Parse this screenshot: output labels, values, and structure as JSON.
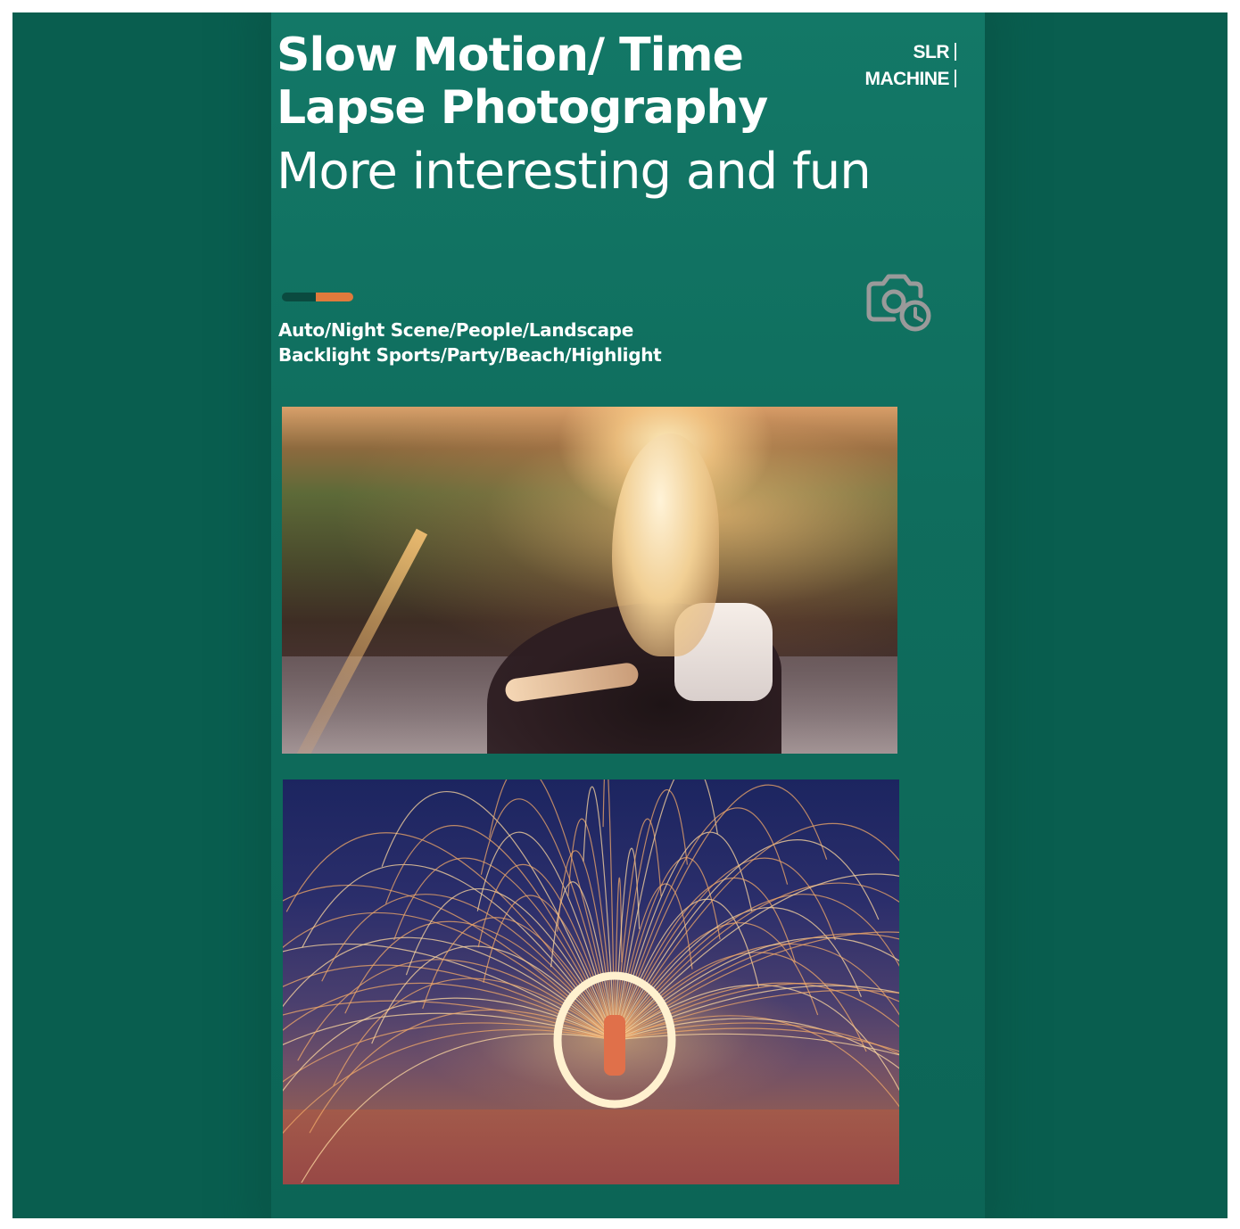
{
  "header": {
    "title_line1": "Slow Motion/ Time",
    "title_line2": "Lapse Photography",
    "subtitle": "More interesting and fun"
  },
  "brand": {
    "line1": "SLR",
    "line2": "MACHINE"
  },
  "modes": {
    "line1": "Auto/Night Scene/People/Landscape",
    "line2": "Backlight Sports/Party/Beach/Highlight"
  },
  "icons": {
    "camera_timer": "camera-timer-icon"
  },
  "colors": {
    "background": "#095e4f",
    "panel": "#137867",
    "accent_dark": "#0a4a3f",
    "accent_orange": "#e07a3c",
    "text": "#ffffff",
    "icon_stroke": "#9a9a9a"
  },
  "photos": [
    {
      "name": "sunset-portrait-photo"
    },
    {
      "name": "steel-wool-sparks-photo"
    }
  ]
}
